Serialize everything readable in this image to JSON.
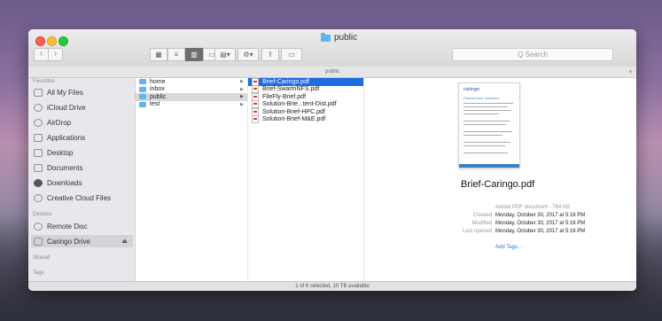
{
  "window": {
    "title": "public"
  },
  "search": {
    "placeholder": "Q Search"
  },
  "pathbar": {
    "label": "public",
    "plus": "+"
  },
  "toolbar": {
    "back": "‹",
    "forward": "›"
  },
  "sidebar": {
    "sections": {
      "favorites": "Favorites",
      "devices": "Devices",
      "shared": "Shared",
      "tags": "Tags"
    },
    "favorites": [
      {
        "label": "All My Files",
        "icon": "all-files-icon"
      },
      {
        "label": "iCloud Drive",
        "icon": "cloud-icon"
      },
      {
        "label": "AirDrop",
        "icon": "airdrop-icon"
      },
      {
        "label": "Applications",
        "icon": "applications-icon"
      },
      {
        "label": "Desktop",
        "icon": "desktop-icon"
      },
      {
        "label": "Documents",
        "icon": "documents-icon"
      },
      {
        "label": "Downloads",
        "icon": "downloads-icon"
      },
      {
        "label": "Creative Cloud Files",
        "icon": "creative-cloud-icon"
      }
    ],
    "devices": [
      {
        "label": "Remote Disc",
        "icon": "disc-icon"
      },
      {
        "label": "Caringo Drive",
        "icon": "drive-icon",
        "eject": "⏏"
      }
    ]
  },
  "column1": [
    {
      "name": "home"
    },
    {
      "name": "inbox"
    },
    {
      "name": "public"
    },
    {
      "name": "test"
    }
  ],
  "column2": [
    {
      "name": "Brief-Caringo.pdf"
    },
    {
      "name": "Brief-SwarmNFS.pdf"
    },
    {
      "name": "FileFly-Brief.pdf"
    },
    {
      "name": "Solution-Brie...tent-Dist.pdf"
    },
    {
      "name": "Solution-Brief-HPC.pdf"
    },
    {
      "name": "Solution-Brief-M&E.pdf"
    }
  ],
  "preview": {
    "thumb_brand": "caringo",
    "thumb_heading": "Product Line Overview",
    "filename": "Brief-Caringo.pdf",
    "kind": "Adobe PDF document - 764 KB",
    "rows": [
      {
        "label": "Created",
        "value": "Monday, October 30, 2017 at 5:16 PM"
      },
      {
        "label": "Modified",
        "value": "Monday, October 30, 2017 at 5:16 PM"
      },
      {
        "label": "Last opened",
        "value": "Monday, October 30, 2017 at 5:16 PM"
      }
    ],
    "add_tags": "Add Tags..."
  },
  "status": {
    "text": "1 of 6 selected, 10 TB available"
  },
  "colors": {
    "selection_blue": "#1d6ce0",
    "folder_blue": "#63b4ee"
  }
}
